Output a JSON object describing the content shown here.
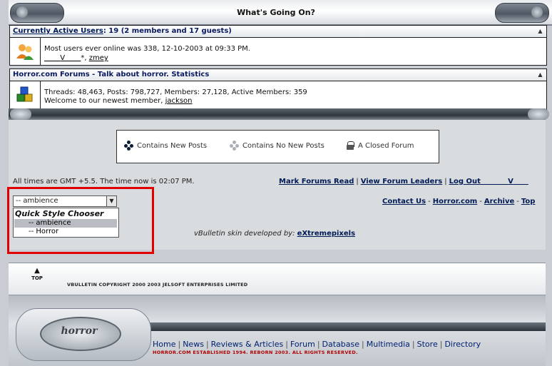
{
  "header": {
    "title": "What's Going On?"
  },
  "active_users": {
    "heading_link": "Currently Active Users",
    "heading_rest": ": 19 (2 members and 17 guests)",
    "record_line": "Most users ever online was 338, 12-10-2003 at 09:33 PM.",
    "member_1": "V",
    "member_1_suffix": "*",
    "member_2": "zmey"
  },
  "stats": {
    "heading": "Horror.com Forums - Talk about horror. Statistics",
    "line1": "Threads: 48,463, Posts: 798,727, Members: 27,128, Active Members: 359",
    "welcome": "Welcome to our newest member,",
    "newest_member": "jackson"
  },
  "legend": {
    "new_posts": "Contains New Posts",
    "no_new_posts": "Contains No New Posts",
    "closed": "A Closed Forum"
  },
  "footer": {
    "timezone": "All times are GMT +5.5. The time now is 02:07 PM.",
    "mark_read": "Mark Forums Read",
    "view_leaders": "View Forum Leaders",
    "logout": "Log Out",
    "logout_user": "V",
    "contact": "Contact Us",
    "home_site": "Horror.com",
    "archive": "Archive",
    "top": "Top"
  },
  "style_chooser": {
    "selected": "-- ambience",
    "group_label": "Quick Style Chooser",
    "options": [
      "-- ambience",
      "-- Horror"
    ]
  },
  "credit": {
    "text": "vBulletin skin developed by:",
    "link": "eXtremepixels"
  },
  "copyright": {
    "top_label": "TOP",
    "text": "VBULLETIN COPYRIGHT 2000 2003 JELSOFT ENTERPRISES LIMITED"
  },
  "site_footer": {
    "logo": "horror",
    "nav": [
      "Home",
      "News",
      "Reviews & Articles",
      "Forum",
      "Database",
      "Multimedia",
      "Store",
      "Directory"
    ],
    "established": "HORROR.COM ESTABLISHED 1994. REBORN 2003. ALL RIGHTS RESERVED."
  }
}
